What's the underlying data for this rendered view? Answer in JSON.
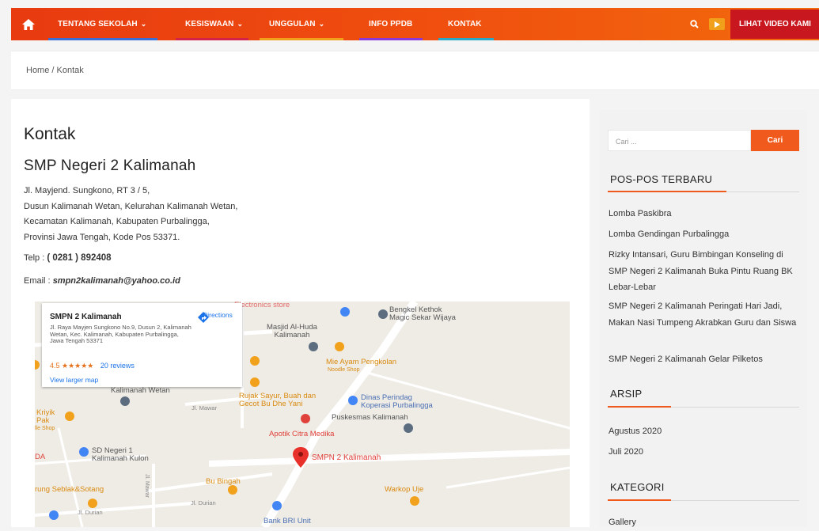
{
  "nav": {
    "items": [
      {
        "label": "TENTANG SEKOLAH",
        "chevron": true,
        "underline": "#3a6fd8"
      },
      {
        "label": "KESISWAAN",
        "chevron": true,
        "underline": "#d4234a"
      },
      {
        "label": "UNGGULAN",
        "chevron": true,
        "underline": "#f0a01a"
      },
      {
        "label": "INFO PPDB",
        "chevron": false,
        "underline": "#8a3ad8"
      },
      {
        "label": "KONTAK",
        "chevron": false,
        "underline": "#29a9c7"
      }
    ],
    "video_label": "LIHAT VIDEO KAMI",
    "icons": {
      "home": "home-icon",
      "search": "search-icon",
      "video": "video-icon"
    }
  },
  "breadcrumb": {
    "home": "Home",
    "separator": "/",
    "current": "Kontak"
  },
  "main": {
    "page_title": "Kontak",
    "school_name": "SMP Negeri 2 Kalimanah",
    "address_lines": [
      "Jl. Mayjend. Sungkono, RT 3 / 5,",
      "Dusun Kalimanah Wetan, Kelurahan Kalimanah Wetan,",
      "Kecamatan Kalimanah, Kabupaten Purbalingga,",
      "Provinsi Jawa Tengah, Kode Pos 53371."
    ],
    "telp_label": "Telp :",
    "telp_value": "( 0281 ) 892408",
    "email_label": "Email :",
    "email_value": "smpn2kalimanah@yahoo.co.id"
  },
  "map": {
    "info": {
      "title": "SMPN 2 Kalimanah",
      "address": "Jl. Raya Mayjen Sungkono No.9, Dusun 2, Kalimanah Wetan, Kec. Kalimanah, Kabupaten Purbalingga, Jawa Tengah 53371",
      "rating": "4.5",
      "stars": "★★★★★",
      "reviews": "20 reviews",
      "larger": "View larger map",
      "directions": "Directions"
    },
    "labels": {
      "top_left": "ari Kalimanah Wetan",
      "electronics": "Electronics store",
      "bengkel": "Bengkel Kethok\nMagic Sekar Wijaya",
      "masjid": "Masjid Al-Huda\nKalimanah",
      "mie": "Mie Ayam Pengkolan",
      "mie_sub": "Noodle Shop",
      "kal_wetan": "Kalimanah Wetan",
      "rujak": "Rujak Sayur, Buah dan\nGecot Bu Dhe Yani",
      "mawar": "Jl. Mawar",
      "dinas": "Dinas Perindag\nKoperasi Purbalingga",
      "puskesmas": "Puskesmas Kalimanah",
      "kriyik": "Kriyik\nPak",
      "kriyik_sub": "lle Shop",
      "apotik": "Apotik Citra Medika",
      "sdn": "SD Negeri 1\nKalimanah Kulon",
      "da": "DA",
      "smpn": "SMPN 2 Kalimanah",
      "warung": "rung Seblak&Sotang",
      "bu_bingah": "Bu Bingah",
      "mawar_v": "Jl. Mawar",
      "warkop": "Warkop Uje",
      "durian1": "Jl. Durian",
      "durian2": "Jl. Durian",
      "bank": "Bank BRI Unit"
    }
  },
  "sidebar": {
    "search_placeholder": "Cari ...",
    "search_button": "Cari",
    "recent_title": "POS-POS TERBARU",
    "recent_posts": [
      "Lomba Paskibra",
      "Lomba Gendingan Purbalingga",
      "Rizky Intansari, Guru Bimbingan Konseling di SMP Negeri 2 Kalimanah Buka Pintu Ruang BK Lebar-Lebar",
      "SMP Negeri 2 Kalimanah Peringati Hari Jadi, Makan Nasi Tumpeng Akrabkan Guru dan Siswa",
      "SMP Negeri 2 Kalimanah Gelar Pilketos"
    ],
    "archive_title": "ARSIP",
    "archives": [
      "Agustus 2020",
      "Juli 2020"
    ],
    "category_title": "KATEGORI",
    "categories": [
      "Gallery"
    ]
  },
  "colors": {
    "accent": "#f05a1d",
    "nav_red": "#c8171e"
  }
}
